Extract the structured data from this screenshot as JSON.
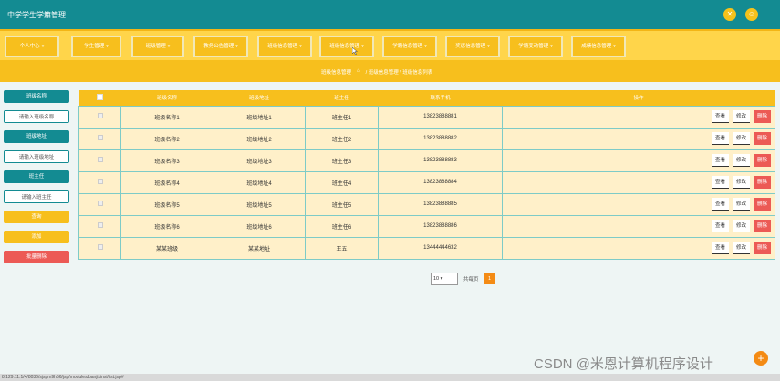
{
  "app": {
    "title": "中学学生学籍管理"
  },
  "top_icons": [
    {
      "name": "close-icon",
      "glyph": "✕"
    },
    {
      "name": "user-icon",
      "glyph": "☺"
    }
  ],
  "nav": {
    "items": [
      {
        "label": "个人中心"
      },
      {
        "label": "学生管理"
      },
      {
        "label": "班级管理"
      },
      {
        "label": "教务公告管理"
      },
      {
        "label": "班级信息管理"
      },
      {
        "label": "班级信息管理"
      },
      {
        "label": "学籍信息管理"
      },
      {
        "label": "奖惩信息管理"
      },
      {
        "label": "学籍变动管理"
      },
      {
        "label": "成绩信息管理"
      }
    ]
  },
  "breadcrumb": {
    "current_title": "班级信息管理",
    "path": "/ 班级信息管理 / 班级信息列表"
  },
  "sidebar": {
    "class_name_label": "班级名称",
    "class_name_placeholder": "请输入班级名称",
    "class_addr_label": "班级地址",
    "class_addr_placeholder": "请输入班级地址",
    "head_teacher_label": "班主任",
    "head_teacher_placeholder": "请输入班主任",
    "search_label": "查询",
    "add_label": "添加",
    "batch_delete_label": "批量删除"
  },
  "table": {
    "headers": [
      "",
      "班级名称",
      "班级地址",
      "班主任",
      "联系手机",
      "操作"
    ],
    "rows": [
      {
        "name": "班级名称1",
        "addr": "班级地址1",
        "teacher": "班主任1",
        "phone": "13823888881"
      },
      {
        "name": "班级名称2",
        "addr": "班级地址2",
        "teacher": "班主任2",
        "phone": "13823888882"
      },
      {
        "name": "班级名称3",
        "addr": "班级地址3",
        "teacher": "班主任3",
        "phone": "13823888883"
      },
      {
        "name": "班级名称4",
        "addr": "班级地址4",
        "teacher": "班主任4",
        "phone": "13823888884"
      },
      {
        "name": "班级名称5",
        "addr": "班级地址5",
        "teacher": "班主任5",
        "phone": "13823888885"
      },
      {
        "name": "班级名称6",
        "addr": "班级地址6",
        "teacher": "班主任6",
        "phone": "13823888886"
      },
      {
        "name": "某某班级",
        "addr": "某某地址",
        "teacher": "王五",
        "phone": "13444444632"
      }
    ],
    "actions": {
      "view": "查看",
      "edit": "修改",
      "delete": "删除"
    }
  },
  "pager": {
    "page_size": "10",
    "goto_label": "共每页",
    "current_page": "1"
  },
  "status": {
    "url": "8.129.11.1/4/8036/sjspm9h56/jsp/modules/banjixinxi/list.jsp#"
  },
  "watermark": "CSDN @米恩计算机程序设计",
  "colors": {
    "teal": "#138b92",
    "yellow": "#f7bf1d",
    "red": "#ec5a55",
    "orange": "#f48b14"
  }
}
